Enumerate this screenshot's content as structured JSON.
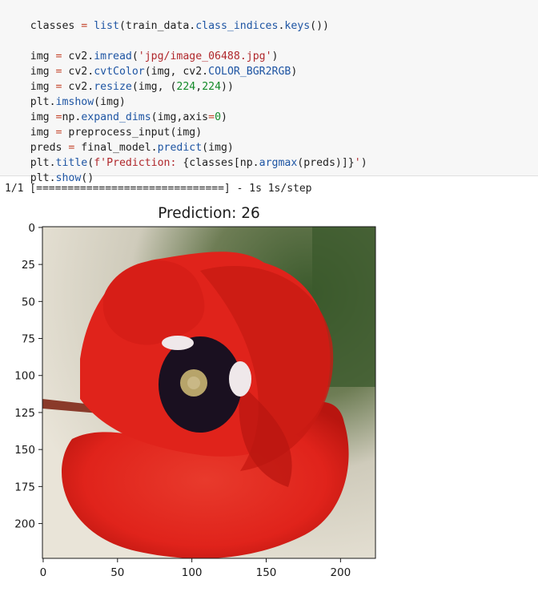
{
  "code": {
    "line1": [
      "classes",
      " = ",
      "list",
      "(train_data.",
      "class_indices",
      ".",
      "keys",
      "())"
    ],
    "line3": [
      "img",
      " = ",
      "cv2.",
      "imread",
      "(",
      "'jpg/image_06488.jpg'",
      ")"
    ],
    "line4": [
      "img",
      " = ",
      "cv2.",
      "cvtColor",
      "(img, cv2.",
      "COLOR_BGR2RGB",
      ")"
    ],
    "line5": [
      "img",
      " = ",
      "cv2.",
      "resize",
      "(img, (",
      "224",
      ",",
      "224",
      "))"
    ],
    "line6": [
      "plt.",
      "imshow",
      "(img)"
    ],
    "line7": [
      "img",
      " =",
      "np.",
      "expand_dims",
      "(img,axis",
      "=",
      "0",
      ")"
    ],
    "line8": [
      "img",
      " = ",
      "preprocess_input",
      "(img)"
    ],
    "line9": [
      "preds",
      " = ",
      "final_model.",
      "predict",
      "(img)"
    ],
    "line10": [
      "plt.",
      "title",
      "(",
      "f'Prediction: ",
      "{classes[np.",
      "argmax",
      "(preds)]}",
      "'",
      ")"
    ],
    "line11": [
      "plt.",
      "show",
      "()"
    ]
  },
  "output": {
    "progress": "1/1 [==============================] - 1s 1s/step"
  },
  "plot": {
    "title": "Prediction: 26",
    "x_ticks": [
      "0",
      "50",
      "100",
      "150",
      "200"
    ],
    "y_ticks": [
      "0",
      "25",
      "50",
      "75",
      "100",
      "125",
      "150",
      "175",
      "200"
    ],
    "image_size": [
      224,
      224
    ],
    "colors": {
      "petal": "#e0231b",
      "petal_dark": "#b8150f",
      "center": "#1a1020",
      "stigma": "#b7a46a",
      "background_light": "#e9e4d8",
      "background_green": "#3b5a2c"
    }
  }
}
